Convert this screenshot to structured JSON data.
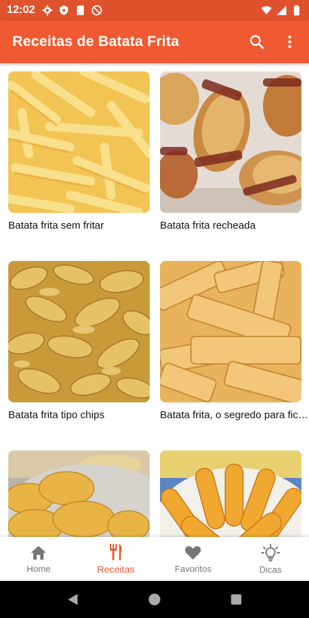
{
  "status_bar": {
    "time": "12:02"
  },
  "app_bar": {
    "title": "Receitas de Batata Frita",
    "background": "#f05a32"
  },
  "recipes": [
    {
      "title": "Batata frita sem fritar"
    },
    {
      "title": "Batata frita recheada"
    },
    {
      "title": "Batata frita tipo chips"
    },
    {
      "title": "Batata frita, o segredo para ficar crocante"
    },
    {
      "title": ""
    },
    {
      "title": ""
    }
  ],
  "bottom_nav": {
    "items": [
      {
        "label": "Home",
        "icon": "home-icon"
      },
      {
        "label": "Receitas",
        "icon": "utensils-icon"
      },
      {
        "label": "Favoritos",
        "icon": "heart-icon"
      },
      {
        "label": "Dicas",
        "icon": "lightbulb-icon"
      }
    ],
    "active": "Receitas",
    "active_color": "#f05a32"
  }
}
